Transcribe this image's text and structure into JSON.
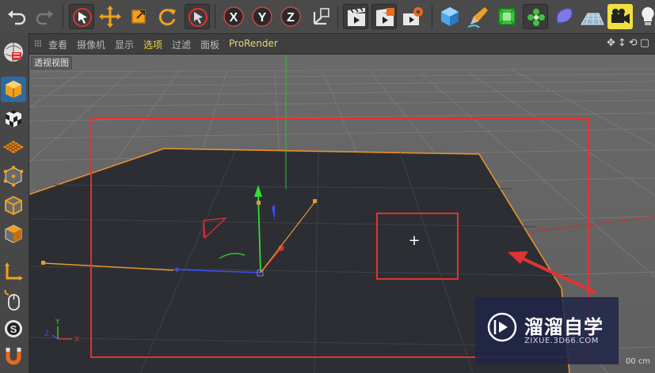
{
  "menu": {
    "items": [
      {
        "label": "查看"
      },
      {
        "label": "摄像机"
      },
      {
        "label": "显示"
      },
      {
        "label": "选项"
      },
      {
        "label": "过滤"
      },
      {
        "label": "面板"
      },
      {
        "label": "ProRender"
      }
    ],
    "active_item": "选项"
  },
  "toolbar": {
    "icons": [
      "undo-icon",
      "redo-icon",
      "live-selection-icon",
      "move-icon",
      "scale-icon",
      "rotate-icon",
      "last-tool-icon",
      "x-axis-lock-icon",
      "y-axis-lock-icon",
      "z-axis-lock-icon",
      "coordinate-system-icon",
      "render-view-icon",
      "render-to-picture-viewer-icon",
      "render-settings-icon",
      "cube-icon",
      "pen-spline-icon",
      "subdivision-icon",
      "array-icon",
      "deformer-icon",
      "floor-icon",
      "camera-icon",
      "light-icon"
    ],
    "axis_labels": {
      "x": "X",
      "y": "Y",
      "z": "Z"
    }
  },
  "left_toolbar": {
    "icons": [
      "make-editable-icon",
      "model-mode-icon",
      "texture-mode-icon",
      "workplane-icon",
      "points-mode-icon",
      "edges-mode-icon",
      "polygons-mode-icon",
      "axis-mode-icon",
      "tweak-mode-icon",
      "snap-icon",
      "magnet-icon"
    ]
  },
  "viewport": {
    "label": "透视视图",
    "world_axis": {
      "x": "X",
      "y": "Y",
      "z": "Z"
    },
    "status": "00 cm",
    "cursor": "+"
  },
  "watermark": {
    "title": "溜溜自学",
    "url": "ZIXUE.3D66.COM"
  },
  "colors": {
    "selection_yellow": "#f0e040",
    "annotation_red": "#e03333",
    "menu_active": "#f2d33a",
    "outline_orange": "#e8912e",
    "axis_x": "#e03030",
    "axis_y": "#30d030",
    "axis_z": "#3050f0"
  }
}
